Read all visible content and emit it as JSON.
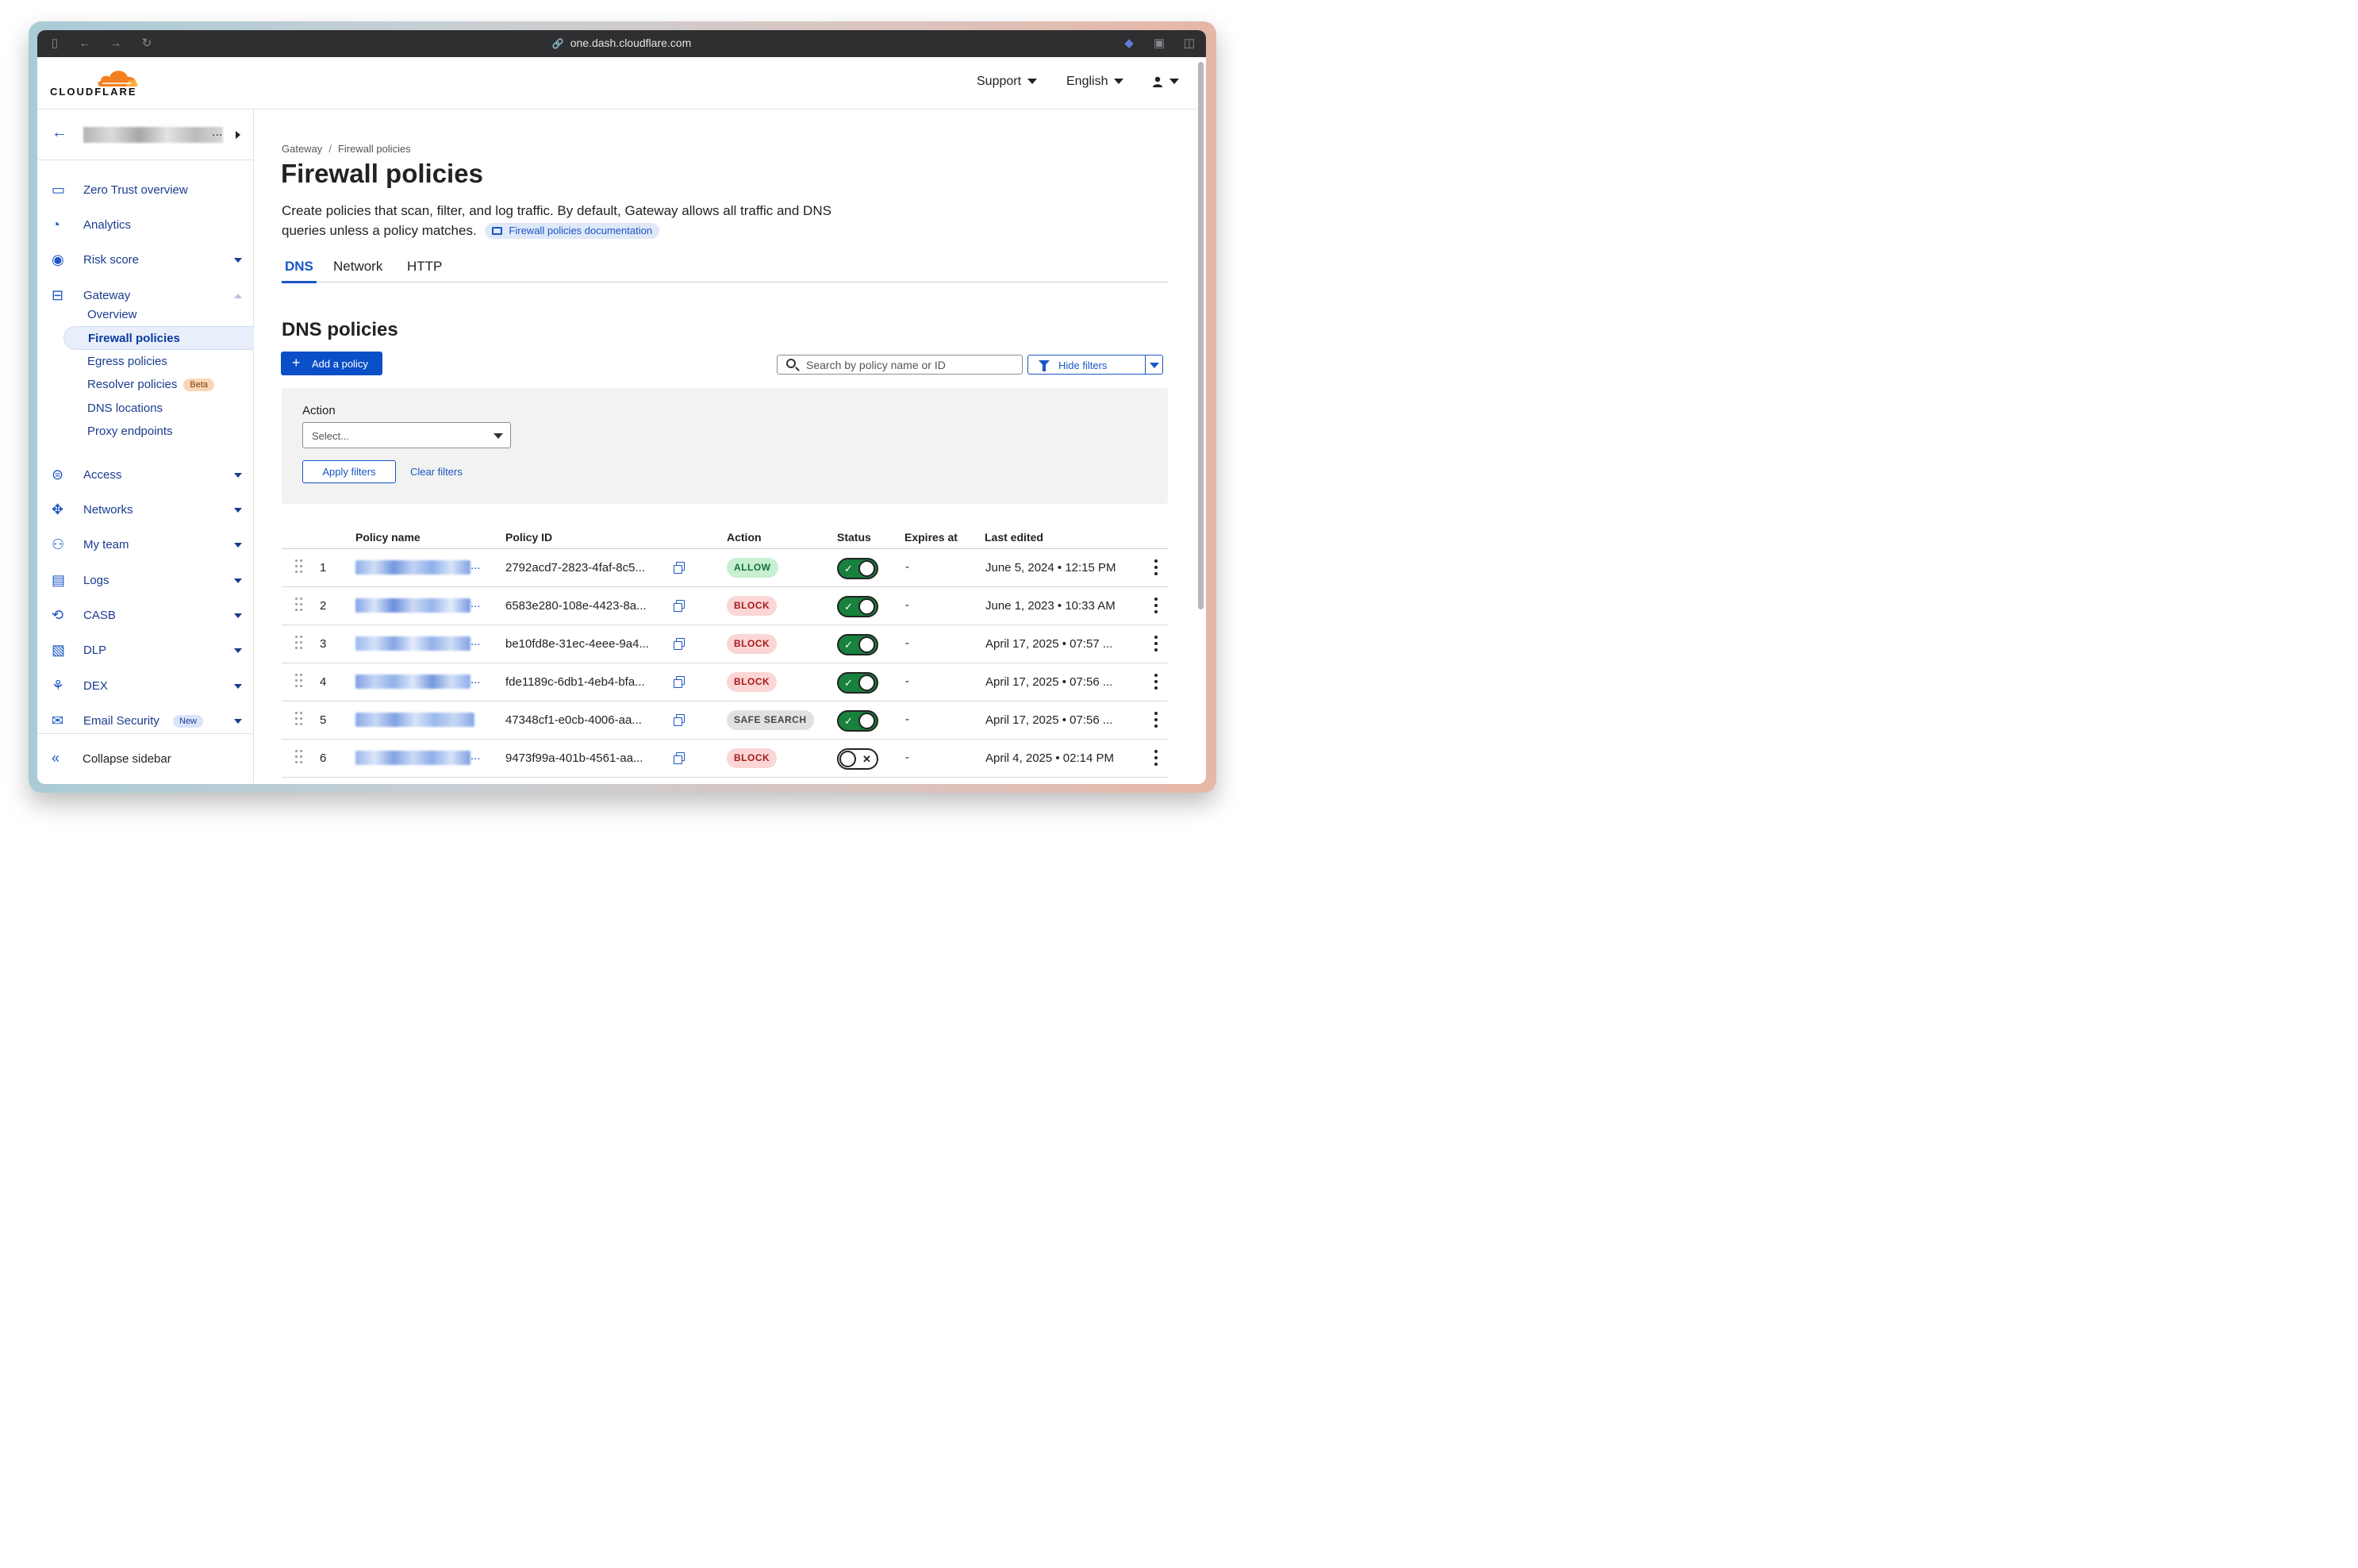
{
  "browser": {
    "url": "one.dash.cloudflare.com"
  },
  "brand": {
    "logo_text": "CLOUDFLARE",
    "accent": "#f38020",
    "primary": "#0b4fc8"
  },
  "topbar": {
    "support_label": "Support",
    "language_label": "English"
  },
  "sidebar": {
    "items": [
      {
        "label": "Zero Trust overview",
        "icon": "browser-window-icon",
        "caret": "none"
      },
      {
        "label": "Analytics",
        "icon": "pie-chart-icon",
        "caret": "none"
      },
      {
        "label": "Risk score",
        "icon": "risk-gauge-icon",
        "caret": "down"
      },
      {
        "label": "Gateway",
        "icon": "gateway-icon",
        "caret": "up"
      },
      {
        "label": "Access",
        "icon": "access-icon",
        "caret": "down"
      },
      {
        "label": "Networks",
        "icon": "network-icon",
        "caret": "down"
      },
      {
        "label": "My team",
        "icon": "team-icon",
        "caret": "down"
      },
      {
        "label": "Logs",
        "icon": "logs-icon",
        "caret": "down"
      },
      {
        "label": "CASB",
        "icon": "casb-icon",
        "caret": "down"
      },
      {
        "label": "DLP",
        "icon": "dlp-icon",
        "caret": "down"
      },
      {
        "label": "DEX",
        "icon": "dex-icon",
        "caret": "down"
      },
      {
        "label": "Email Security",
        "icon": "email-security-icon",
        "caret": "down",
        "badge": "New"
      }
    ],
    "gateway_sub": [
      {
        "label": "Overview"
      },
      {
        "label": "Firewall policies",
        "active": true
      },
      {
        "label": "Egress policies"
      },
      {
        "label": "Resolver policies",
        "badge": "Beta"
      },
      {
        "label": "DNS locations"
      },
      {
        "label": "Proxy endpoints"
      }
    ],
    "collapse_label": "Collapse sidebar"
  },
  "main": {
    "breadcrumb": [
      "Gateway",
      "Firewall policies"
    ],
    "title": "Firewall policies",
    "description": "Create policies that scan, filter, and log traffic. By default, Gateway allows all traffic and DNS queries unless a policy matches.",
    "doc_link": "Firewall policies documentation",
    "tabs": [
      {
        "label": "DNS",
        "active": true
      },
      {
        "label": "Network"
      },
      {
        "label": "HTTP"
      }
    ],
    "section_title": "DNS policies",
    "add_button": "Add a policy",
    "search_placeholder": "Search by policy name or ID",
    "hide_filters": "Hide filters",
    "filters": {
      "action_label": "Action",
      "action_placeholder": "Select...",
      "apply": "Apply filters",
      "clear": "Clear filters"
    },
    "table": {
      "columns": [
        "Policy name",
        "Policy ID",
        "Action",
        "Status",
        "Expires at",
        "Last edited"
      ],
      "rows": [
        {
          "num": "1",
          "name_dots": "...",
          "policy_id": "2792acd7-2823-4faf-8c5...",
          "action": "ALLOW",
          "action_type": "allow",
          "enabled": true,
          "status_mark": "✓",
          "expires": "-",
          "edited": "June 5, 2024 • 12:15 PM"
        },
        {
          "num": "2",
          "name_dots": "...",
          "policy_id": "6583e280-108e-4423-8a...",
          "action": "BLOCK",
          "action_type": "block",
          "enabled": true,
          "status_mark": "✓",
          "expires": "-",
          "edited": "June 1, 2023 • 10:33 AM"
        },
        {
          "num": "3",
          "name_dots": "...",
          "policy_id": "be10fd8e-31ec-4eee-9a4...",
          "action": "BLOCK",
          "action_type": "block",
          "enabled": true,
          "status_mark": "✓",
          "expires": "-",
          "edited": "April 17, 2025 • 07:57 ..."
        },
        {
          "num": "4",
          "name_dots": "...",
          "policy_id": "fde1189c-6db1-4eb4-bfa...",
          "action": "BLOCK",
          "action_type": "block",
          "enabled": true,
          "status_mark": "✓",
          "expires": "-",
          "edited": "April 17, 2025 • 07:56 ..."
        },
        {
          "num": "5",
          "name_dots": "",
          "policy_id": "47348cf1-e0cb-4006-aa...",
          "action": "SAFE SEARCH",
          "action_type": "safe",
          "enabled": true,
          "status_mark": "✓",
          "expires": "-",
          "edited": "April 17, 2025 • 07:56 ..."
        },
        {
          "num": "6",
          "name_dots": "...",
          "policy_id": "9473f99a-401b-4561-aa...",
          "action": "BLOCK",
          "action_type": "block",
          "enabled": false,
          "status_mark": "✕",
          "expires": "-",
          "edited": "April 4, 2025 • 02:14 PM"
        }
      ]
    }
  }
}
